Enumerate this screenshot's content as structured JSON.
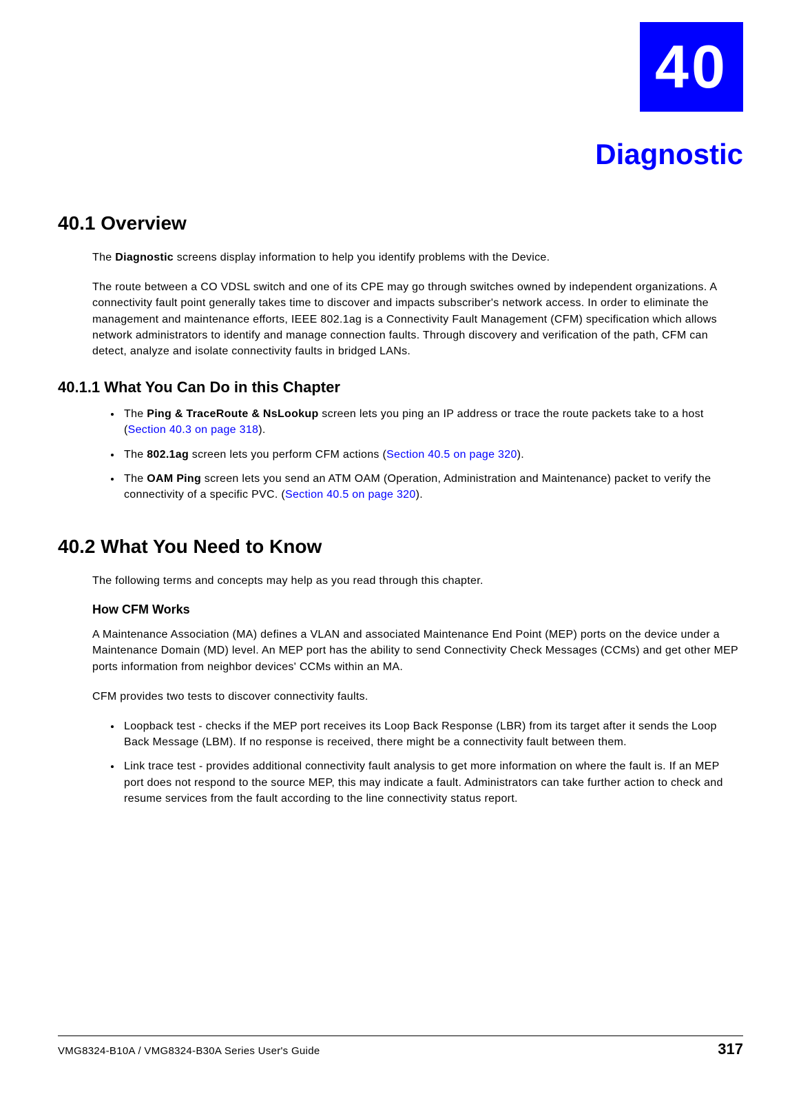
{
  "chapter": {
    "number": "40",
    "title": "Diagnostic"
  },
  "s1": {
    "heading": "40.1  Overview",
    "p1a": "The ",
    "p1b": "Diagnostic",
    "p1c": " screens display information to help you identify problems with the Device.",
    "p2": "The route between a CO VDSL switch and one of its CPE may go through switches owned by independent organizations. A connectivity fault point generally takes time to discover and impacts subscriber's network access. In order to eliminate the management and maintenance efforts, IEEE 802.1ag is a Connectivity Fault Management (CFM) specification which allows network administrators to identify and manage connection faults. Through discovery and verification of the path, CFM can detect, analyze and isolate connectivity faults in bridged LANs."
  },
  "s11": {
    "heading": "40.1.1  What You Can Do in this Chapter",
    "b1a": "The ",
    "b1b": "Ping & TraceRoute & NsLookup",
    "b1c": " screen lets you ping an IP address or trace the route packets take to a host (",
    "b1link": "Section 40.3 on page 318",
    "b1d": ").",
    "b2a": "The ",
    "b2b": "802.1ag",
    "b2c": " screen lets you perform CFM actions (",
    "b2link": "Section 40.5 on page 320",
    "b2d": ").",
    "b3a": "The ",
    "b3b": "OAM Ping",
    "b3c": " screen lets you send an ATM OAM (Operation, Administration and Maintenance) packet to verify the connectivity of a specific PVC. (",
    "b3link": "Section 40.5 on page 320",
    "b3d": ")."
  },
  "s2": {
    "heading": "40.2  What You Need to Know",
    "p1": "The following terms and concepts may help as you read through this chapter.",
    "sub1": "How CFM Works",
    "p2": "A Maintenance Association (MA) defines a VLAN and associated Maintenance End Point (MEP) ports on the device under a Maintenance Domain (MD) level. An MEP port has the ability to send Connectivity Check Messages (CCMs) and get other MEP ports information from neighbor devices' CCMs within an MA.",
    "p3": "CFM provides two tests to discover connectivity faults.",
    "b1": "Loopback test - checks if the MEP port receives its Loop Back Response (LBR) from its target after it sends the Loop Back Message (LBM). If no response is received, there might be a connectivity fault between them.",
    "b2": "Link trace test - provides additional connectivity fault analysis to get more information on where the fault is. If an MEP port does not respond to the source MEP, this may indicate a fault. Administrators can take further action to check and resume services from the fault according to the line connectivity status report."
  },
  "footer": {
    "guide": "VMG8324-B10A / VMG8324-B30A Series User's Guide",
    "page": "317"
  }
}
